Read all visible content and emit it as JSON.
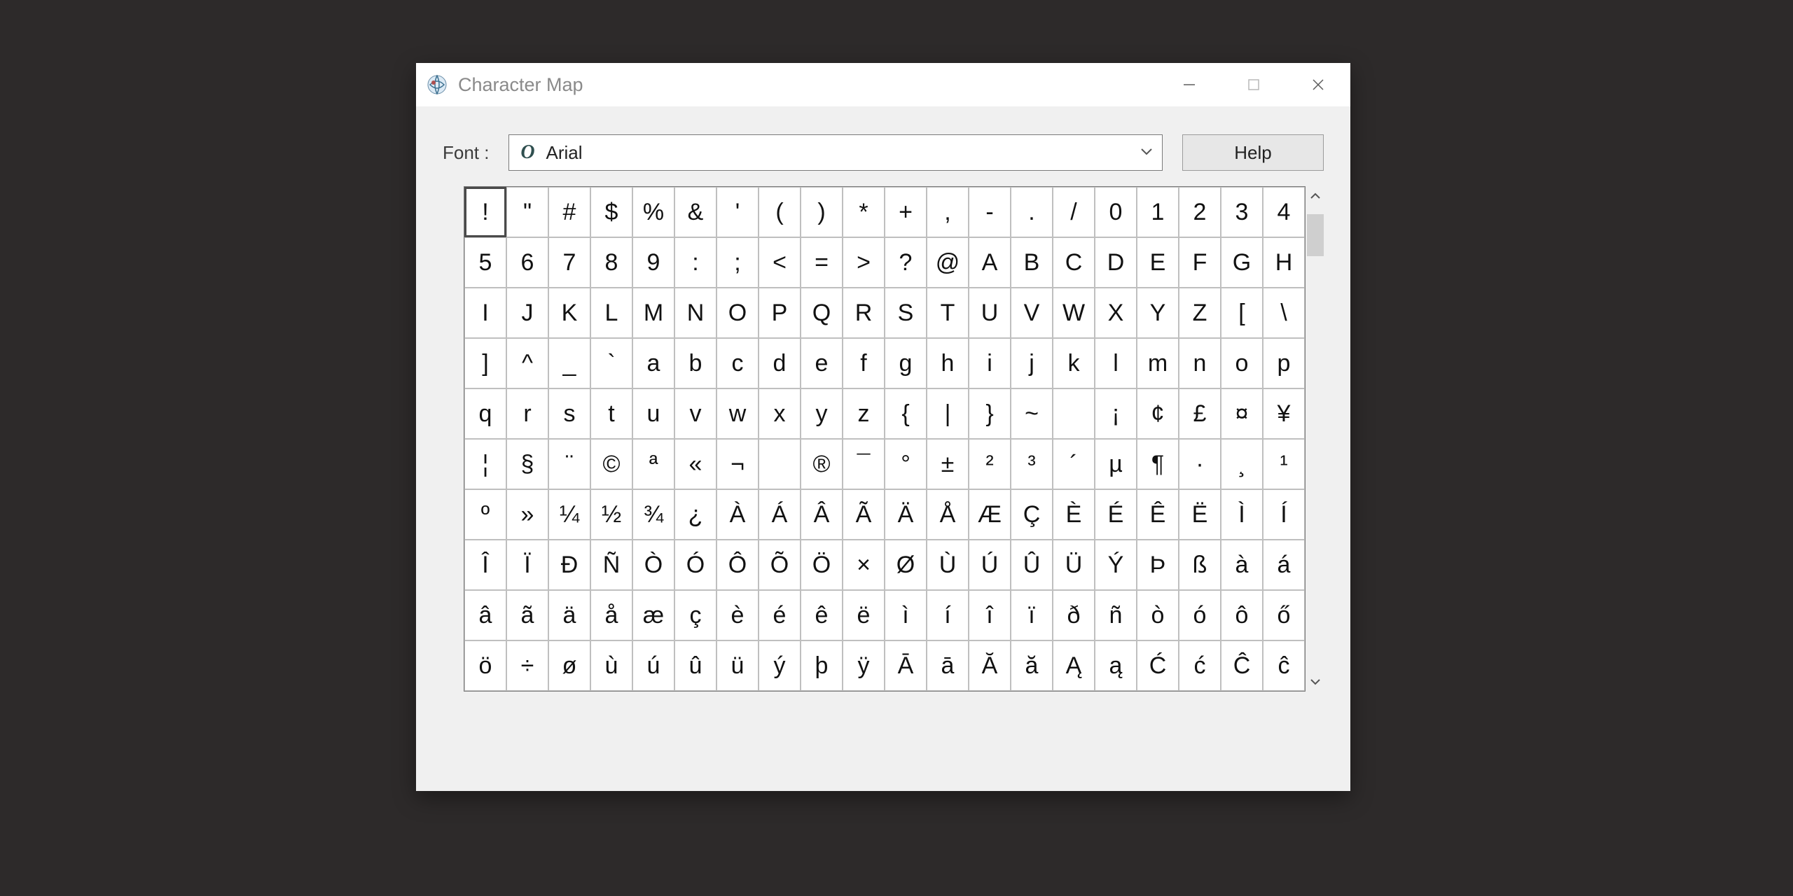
{
  "window": {
    "title": "Character Map"
  },
  "toolbar": {
    "font_label": "Font :",
    "font_value": "Arial",
    "help_label": "Help"
  },
  "grid": {
    "columns": 20,
    "rows": 10,
    "selected_index": 0,
    "chars": [
      "!",
      "\"",
      "#",
      "$",
      "%",
      "&",
      "'",
      "(",
      ")",
      "*",
      "+",
      ",",
      "-",
      ".",
      "/",
      "0",
      "1",
      "2",
      "3",
      "4",
      "5",
      "6",
      "7",
      "8",
      "9",
      ":",
      ";",
      "<",
      "=",
      ">",
      "?",
      "@",
      "A",
      "B",
      "C",
      "D",
      "E",
      "F",
      "G",
      "H",
      "I",
      "J",
      "K",
      "L",
      "M",
      "N",
      "O",
      "P",
      "Q",
      "R",
      "S",
      "T",
      "U",
      "V",
      "W",
      "X",
      "Y",
      "Z",
      "[",
      "\\",
      "]",
      "^",
      "_",
      "`",
      "a",
      "b",
      "c",
      "d",
      "e",
      "f",
      "g",
      "h",
      "i",
      "j",
      "k",
      "l",
      "m",
      "n",
      "o",
      "p",
      "q",
      "r",
      "s",
      "t",
      "u",
      "v",
      "w",
      "x",
      "y",
      "z",
      "{",
      "|",
      "}",
      "~",
      "",
      "¡",
      "¢",
      "£",
      "¤",
      "¥",
      "¦",
      "§",
      "¨",
      "©",
      "ª",
      "«",
      "¬",
      "­",
      "®",
      "¯",
      "°",
      "±",
      "²",
      "³",
      "´",
      "µ",
      "¶",
      "·",
      "¸",
      "¹",
      "º",
      "»",
      "¼",
      "½",
      "¾",
      "¿",
      "À",
      "Á",
      "Â",
      "Ã",
      "Ä",
      "Å",
      "Æ",
      "Ç",
      "È",
      "É",
      "Ê",
      "Ë",
      "Ì",
      "Í",
      "Î",
      "Ï",
      "Ð",
      "Ñ",
      "Ò",
      "Ó",
      "Ô",
      "Õ",
      "Ö",
      "×",
      "Ø",
      "Ù",
      "Ú",
      "Û",
      "Ü",
      "Ý",
      "Þ",
      "ß",
      "à",
      "á",
      "â",
      "ã",
      "ä",
      "å",
      "æ",
      "ç",
      "è",
      "é",
      "ê",
      "ë",
      "ì",
      "í",
      "î",
      "ï",
      "ð",
      "ñ",
      "ò",
      "ó",
      "ô",
      "ő",
      "ö",
      "÷",
      "ø",
      "ù",
      "ú",
      "û",
      "ü",
      "ý",
      "þ",
      "ÿ",
      "Ā",
      "ā",
      "Ă",
      "ă",
      "Ą",
      "ą",
      "Ć",
      "ć",
      "Ĉ",
      "ĉ"
    ]
  }
}
